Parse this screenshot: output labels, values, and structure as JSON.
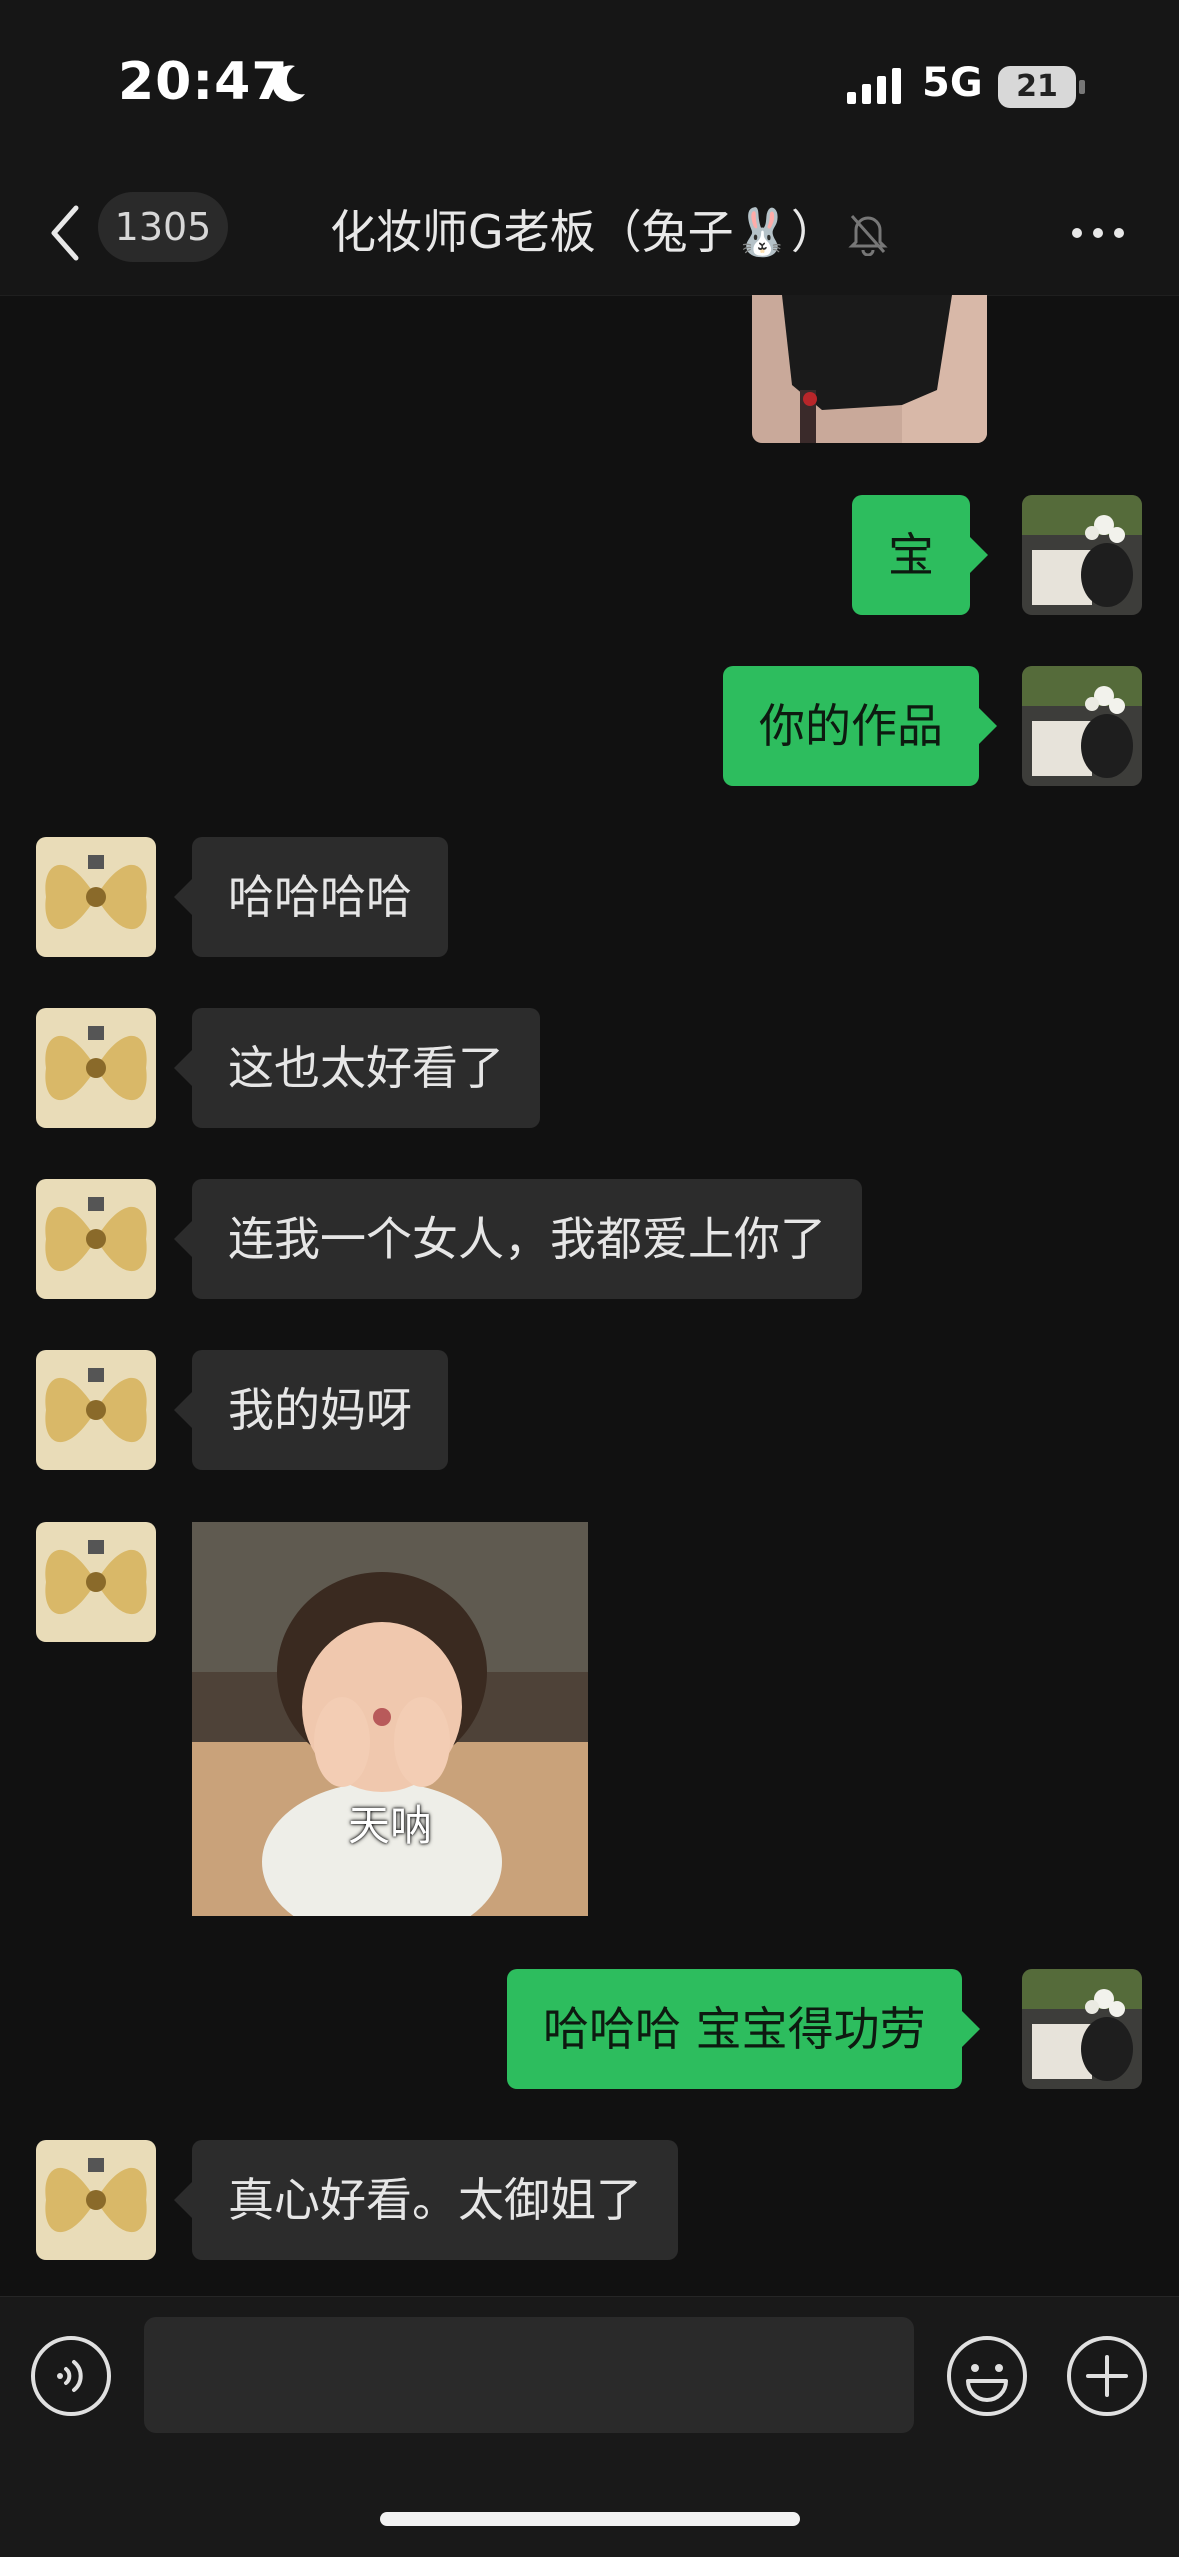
{
  "status_bar": {
    "time": "20:47",
    "network": "5G",
    "battery": "21"
  },
  "nav": {
    "back_count": "1305",
    "title": "化妆师G老板（兔子🐰）"
  },
  "messages": [
    {
      "side": "out",
      "text": "宝"
    },
    {
      "side": "out",
      "text": "你的作品"
    },
    {
      "side": "in",
      "text": "哈哈哈哈"
    },
    {
      "side": "in",
      "text": "这也太好看了"
    },
    {
      "side": "in",
      "text": "连我一个女人，我都爱上你了"
    },
    {
      "side": "in",
      "text": "我的妈呀"
    },
    {
      "side": "in",
      "type": "sticker",
      "caption": "天呐"
    },
    {
      "side": "out",
      "text": "哈哈哈 宝宝得功劳"
    },
    {
      "side": "in",
      "text": "真心好看。太御姐了"
    }
  ],
  "colors": {
    "outgoing_bubble": "#2dbd5e",
    "incoming_bubble": "#2c2c2c",
    "background": "#111111"
  },
  "icons": [
    "moon-icon",
    "signal-icon",
    "back-icon",
    "mute-bell-icon",
    "more-icon",
    "voice-icon",
    "emoji-icon",
    "plus-icon"
  ]
}
